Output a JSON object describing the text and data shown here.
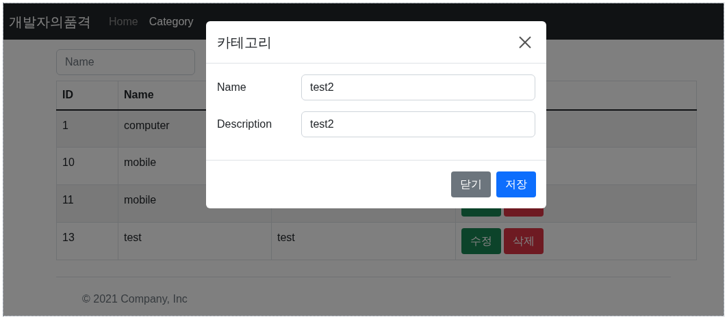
{
  "navbar": {
    "brand": "개발자의품격",
    "links": [
      {
        "label": "Home",
        "selected": false
      },
      {
        "label": "Category",
        "selected": true
      }
    ]
  },
  "search": {
    "placeholder": "Name"
  },
  "table": {
    "columns": [
      "ID",
      "Name"
    ],
    "rows": [
      {
        "id": "1",
        "name": "computer",
        "actions": []
      },
      {
        "id": "10",
        "name": "mobile",
        "actions": []
      },
      {
        "id": "11",
        "name": "mobile",
        "actions": [
          {
            "kind": "edit"
          },
          {
            "kind": "delete"
          }
        ]
      },
      {
        "id": "13",
        "name": "test",
        "description": "test",
        "actions": [
          {
            "kind": "edit",
            "label": "수정"
          },
          {
            "kind": "delete",
            "label": "삭제"
          }
        ]
      }
    ]
  },
  "footer": {
    "text": "© 2021 Company, Inc"
  },
  "modal": {
    "title": "카테고리",
    "fields": [
      {
        "label": "Name",
        "value": "test2"
      },
      {
        "label": "Description",
        "value": "test2"
      }
    ],
    "buttons": [
      {
        "kind": "secondary",
        "label": "닫기"
      },
      {
        "kind": "primary",
        "label": "저장"
      }
    ]
  }
}
